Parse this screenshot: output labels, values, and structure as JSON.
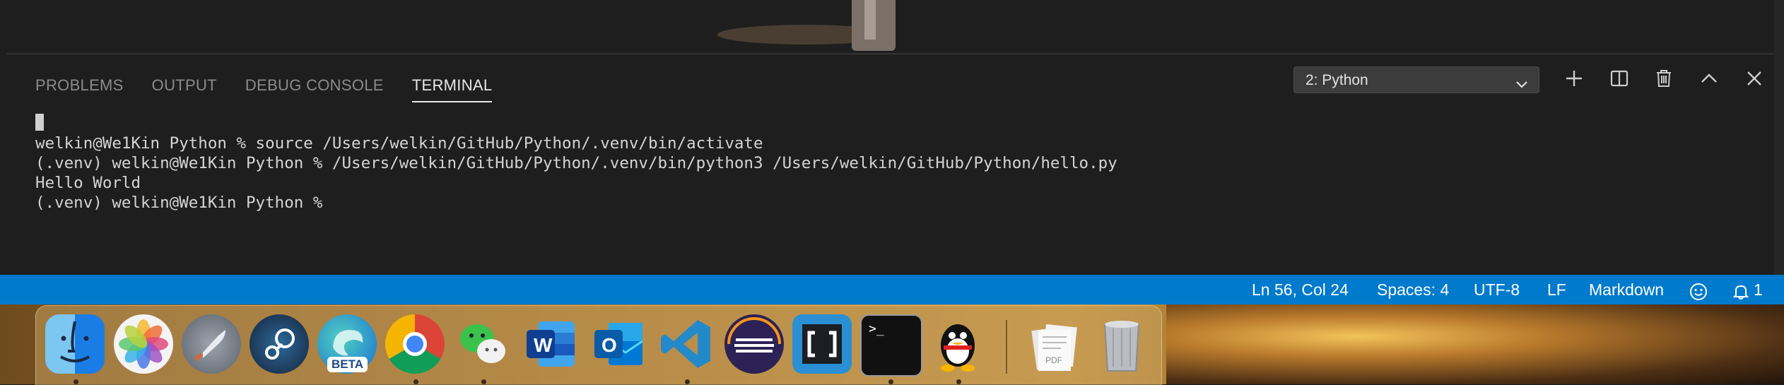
{
  "panel": {
    "tabs": [
      {
        "label": "PROBLEMS",
        "active": false
      },
      {
        "label": "OUTPUT",
        "active": false
      },
      {
        "label": "DEBUG CONSOLE",
        "active": false
      },
      {
        "label": "TERMINAL",
        "active": true
      }
    ],
    "terminal_select": "2: Python",
    "toolbar_icons": [
      "plus-icon",
      "split-icon",
      "trash-icon",
      "chevron-up-icon",
      "close-icon"
    ]
  },
  "terminal": {
    "lines": [
      "welkin@We1Kin Python % source /Users/welkin/GitHub/Python/.venv/bin/activate",
      "(.venv) welkin@We1Kin Python % /Users/welkin/GitHub/Python/.venv/bin/python3 /Users/welkin/GitHub/Python/hello.py",
      "Hello World",
      "(.venv) welkin@We1Kin Python % "
    ]
  },
  "statusbar": {
    "position": "Ln 56, Col 24",
    "spaces": "Spaces: 4",
    "encoding": "UTF-8",
    "eol": "LF",
    "language": "Markdown",
    "notifications": "1"
  },
  "dock": {
    "apps": [
      "Finder",
      "Photos",
      "Launchpad",
      "Steam",
      "Microsoft Edge Beta",
      "Google Chrome",
      "WeChat",
      "Microsoft Word",
      "Microsoft Outlook",
      "Visual Studio Code",
      "Eclipse",
      "Brackets",
      "Terminal",
      "QQ",
      "Documents",
      "Trash"
    ],
    "beta_badge": "BETA",
    "word_letter": "W",
    "outlook_letter": "O",
    "terminal_prompt": ">_",
    "pdf_label": "PDF"
  },
  "colors": {
    "statusbar": "#007acc",
    "panel_bg": "#1e1e1e",
    "tab_inactive": "#8b8b8b",
    "tab_active": "#e7e7e7"
  }
}
